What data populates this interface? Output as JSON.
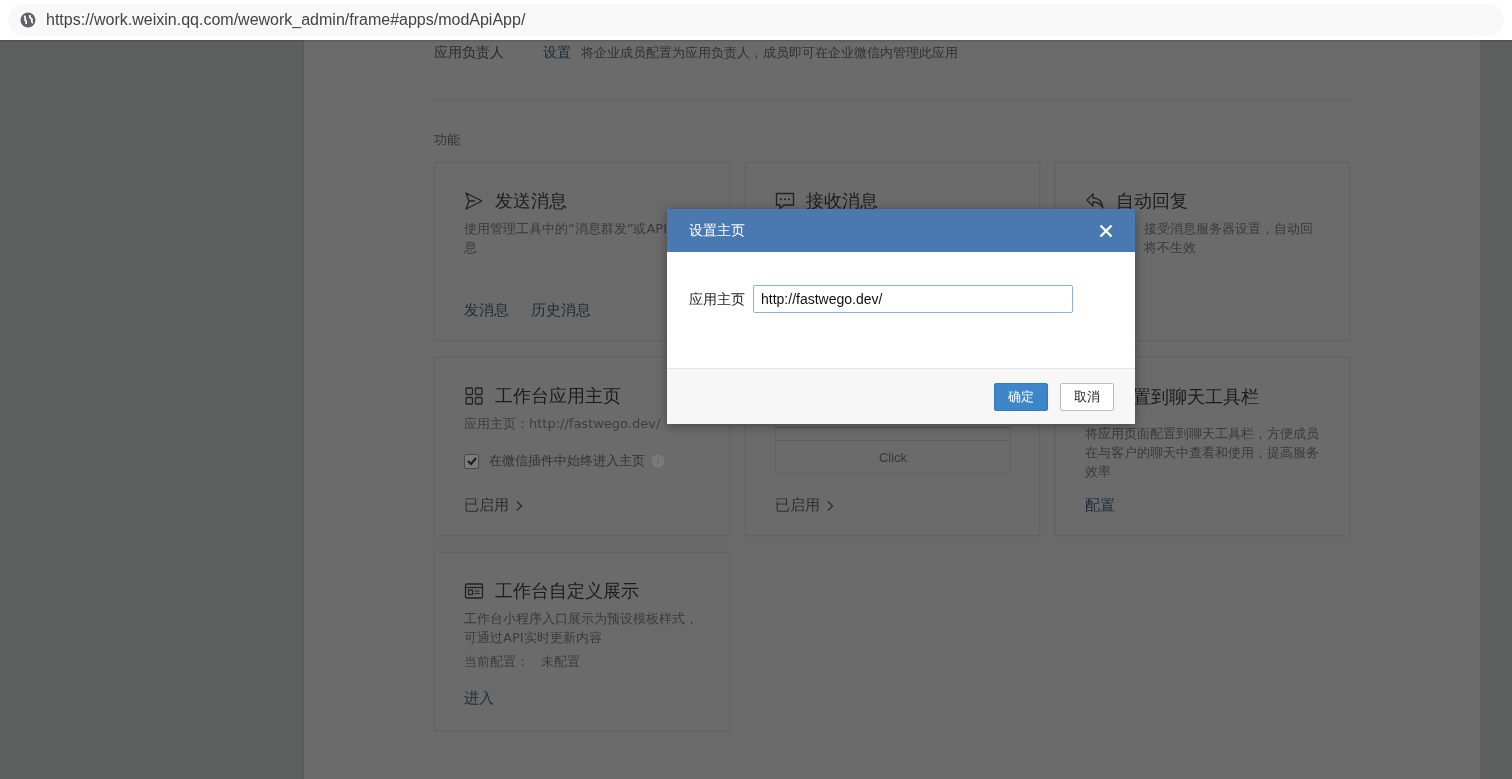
{
  "address_bar": {
    "url": "https://work.weixin.qq.com/wework_admin/frame#apps/modApiApp/"
  },
  "owner": {
    "label": "应用负责人",
    "link": "设置",
    "description": "将企业成员配置为应用负责人，成员即可在企业微信内管理此应用"
  },
  "section_title": "功能",
  "cards": [
    {
      "kind": "send",
      "title": "发送消息",
      "description": [
        "使用管理工具中的“消息群发”或API",
        "息"
      ],
      "links": [
        "发消息",
        "历史消息"
      ]
    },
    {
      "kind": "receive",
      "title": "接收消息"
    },
    {
      "kind": "reply",
      "title": "自动回复",
      "description": [
        "接受消息服务器设置，自动回",
        "将不生效"
      ]
    },
    {
      "kind": "homepage",
      "title": "工作台应用主页",
      "info": "应用主页：http://fastwego.dev/",
      "checkbox": {
        "label": "在微信插件中始终进入主页",
        "checked": true
      },
      "status": "已启用"
    },
    {
      "kind": "menu",
      "preview_button": "Click",
      "status": "已启用"
    },
    {
      "kind": "toolbar",
      "title": "置到聊天工具栏",
      "description": [
        "将应用页面配置到聊天工具栏，方便成员",
        "在与客户的聊天中查看和使用，提高服务",
        "效率"
      ],
      "links": [
        "配置"
      ]
    },
    {
      "kind": "display",
      "title": "工作台自定义展示",
      "description": [
        "工作台小程序入口展示为预设模板样式，",
        "可通过API实时更新内容"
      ],
      "config_label": "当前配置：",
      "config_value": "未配置",
      "links": [
        "进入"
      ]
    }
  ],
  "dialog": {
    "title": "设置主页",
    "field_label": "应用主页",
    "field_value": "http://fastwego.dev/",
    "buttons": [
      {
        "label": "确定",
        "kind": "primary"
      },
      {
        "label": "取消",
        "kind": "default"
      }
    ]
  }
}
